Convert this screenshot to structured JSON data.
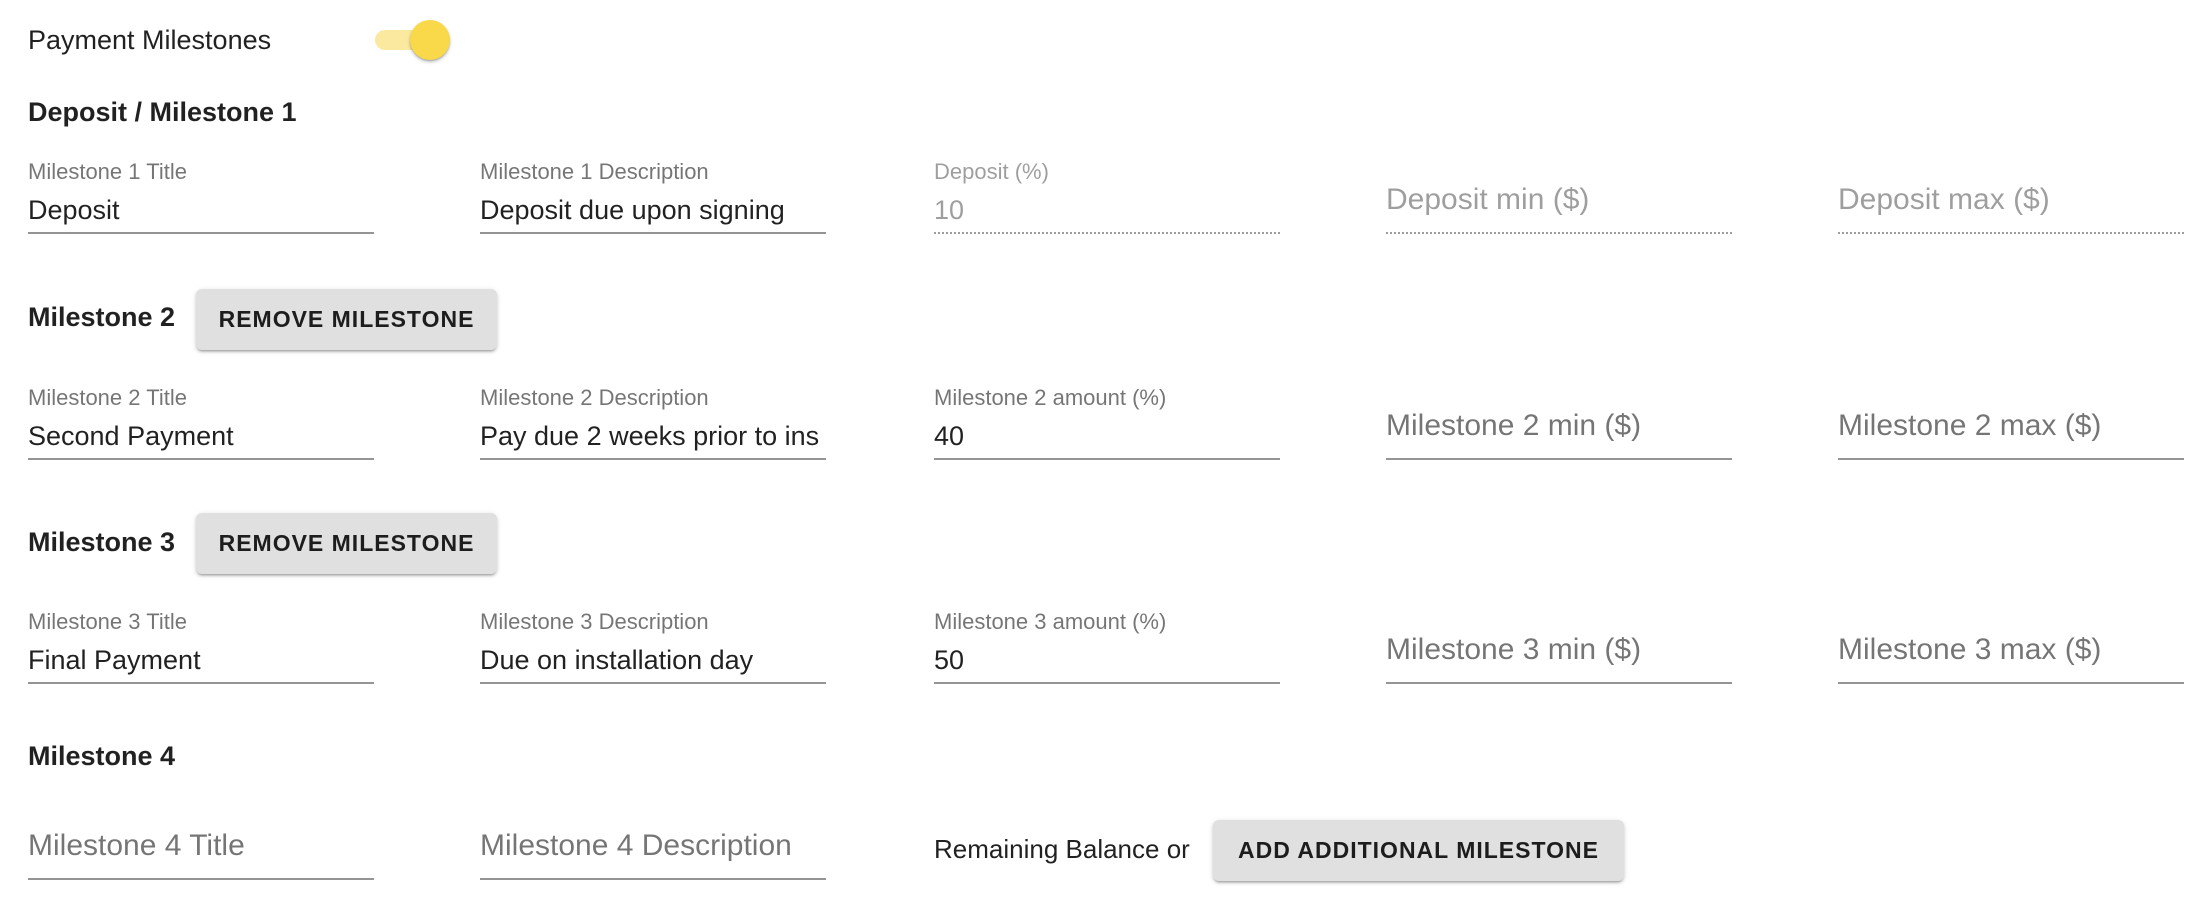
{
  "header": {
    "title": "Payment Milestones",
    "toggle": {
      "name": "payment-milestones-toggle",
      "on": true
    }
  },
  "colors": {
    "toggle_thumb": "#F9D84A",
    "toggle_track": "#FBE9A0",
    "button_bg": "#E0E0E0"
  },
  "milestones": [
    {
      "heading": "Deposit / Milestone 1",
      "title": {
        "label": "Milestone 1 Title",
        "value": "Deposit"
      },
      "description": {
        "label": "Milestone 1 Description",
        "value": "Deposit due upon signing"
      },
      "amount": {
        "label": "Deposit (%)",
        "value": "10",
        "disabled": true
      },
      "min": {
        "placeholder": "Deposit min ($)",
        "disabled": true
      },
      "max": {
        "placeholder": "Deposit max ($)",
        "disabled": true
      }
    },
    {
      "heading": "Milestone 2",
      "remove_label": "Remove Milestone",
      "title": {
        "label": "Milestone 2 Title",
        "value": "Second Payment"
      },
      "description": {
        "label": "Milestone 2 Description",
        "value": "Pay due 2 weeks prior to ins"
      },
      "amount": {
        "label": "Milestone 2 amount (%)",
        "value": "40"
      },
      "min": {
        "placeholder": "Milestone 2 min ($)"
      },
      "max": {
        "placeholder": "Milestone 2 max ($)"
      }
    },
    {
      "heading": "Milestone 3",
      "remove_label": "Remove Milestone",
      "title": {
        "label": "Milestone 3 Title",
        "value": "Final Payment"
      },
      "description": {
        "label": "Milestone 3 Description",
        "value": "Due on installation day"
      },
      "amount": {
        "label": "Milestone 3 amount (%)",
        "value": "50"
      },
      "min": {
        "placeholder": "Milestone 3 min ($)"
      },
      "max": {
        "placeholder": "Milestone 3 max ($)"
      }
    },
    {
      "heading": "Milestone 4",
      "title": {
        "placeholder": "Milestone 4 Title"
      },
      "description": {
        "placeholder": "Milestone 4 Description"
      },
      "remaining_text": "Remaining Balance or",
      "add_label": "Add Additional Milestone"
    }
  ]
}
